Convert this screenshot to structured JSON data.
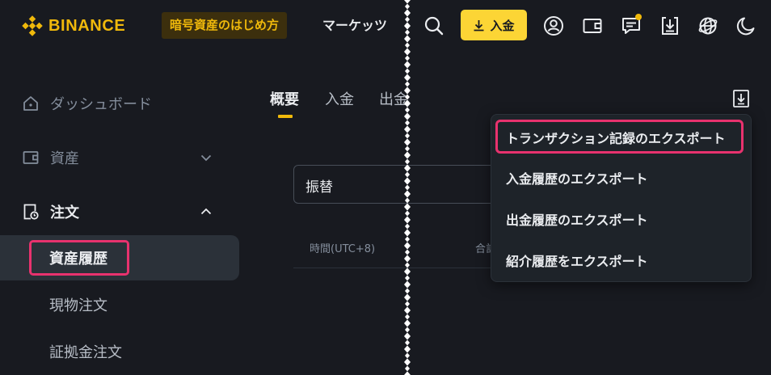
{
  "brand": {
    "name": "BINANCE",
    "color": "#f0b90b"
  },
  "header": {
    "promo_label": "暗号資産のはじめ方",
    "markets_label": "マーケッツ",
    "deposit_label": "入金",
    "icons": [
      "search-icon",
      "deposit-icon",
      "user-icon",
      "wallet-icon",
      "messages-icon",
      "download-app-icon",
      "globe-icon",
      "dark-mode-icon"
    ]
  },
  "sidebar": {
    "items": [
      {
        "label": "ダッシュボード",
        "icon": "home-icon"
      },
      {
        "label": "資産",
        "icon": "wallet-icon",
        "chevron": "chevron-down-icon"
      },
      {
        "label": "注文",
        "icon": "orders-icon",
        "chevron": "chevron-up-icon"
      }
    ],
    "sub_items": [
      {
        "label": "資産履歴",
        "active": true
      },
      {
        "label": "現物注文"
      },
      {
        "label": "証拠金注文"
      }
    ]
  },
  "main": {
    "tabs": [
      {
        "label": "概要",
        "active": true
      },
      {
        "label": "入金"
      },
      {
        "label": "出金"
      }
    ],
    "filter_value": "振替",
    "table_headers": [
      "時間(UTC+8)",
      "合計"
    ]
  },
  "export_menu": {
    "items": [
      {
        "label": "トランザクション記録のエクスポート",
        "highlighted": true
      },
      {
        "label": "入金履歴のエクスポート"
      },
      {
        "label": "出金履歴のエクスポート"
      },
      {
        "label": "紹介履歴をエクスポート"
      }
    ]
  },
  "colors": {
    "accent": "#fcd535",
    "highlight_box": "#e8326e",
    "background": "#181a20"
  }
}
